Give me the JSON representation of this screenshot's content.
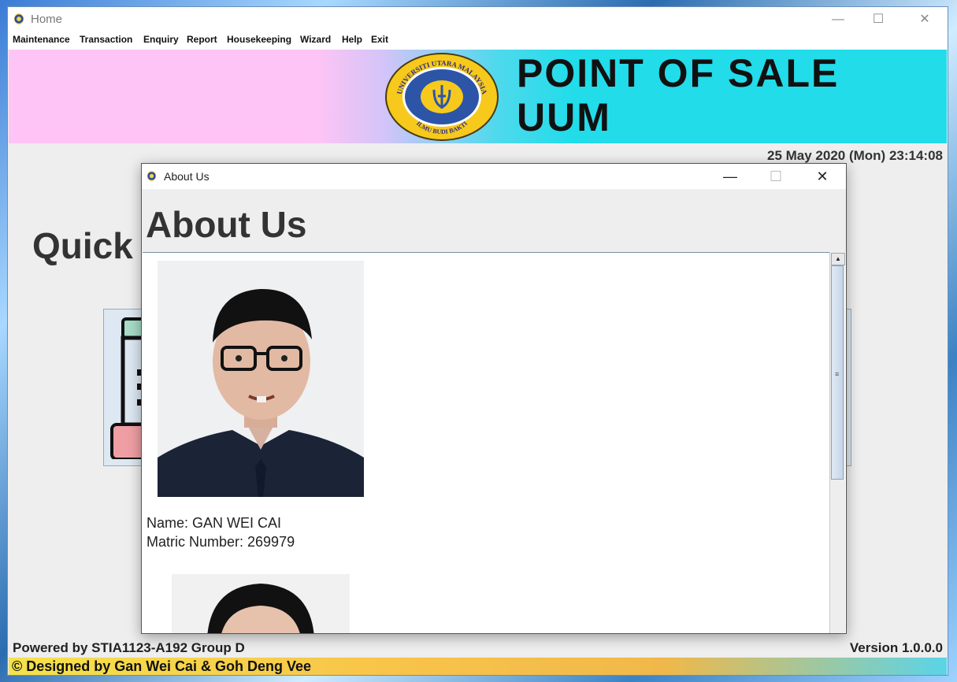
{
  "main_window": {
    "title": "Home",
    "controls": {
      "minimize": "—",
      "maximize": "☐",
      "close": "✕"
    }
  },
  "menu": {
    "items": [
      "Maintenance",
      "Transaction",
      "Enquiry",
      "Report",
      "Housekeeping",
      "Wizard",
      "Help",
      "Exit"
    ]
  },
  "banner": {
    "title": "POINT OF SALE",
    "subtitle": "UUM",
    "logo_text": "UNIVERSITI UTARA MALAYSIA",
    "logo_motto": "ILMU BUDI BAKTI"
  },
  "datetime": "25 May 2020 (Mon) 23:14:08",
  "quick_access": {
    "title": "Quick"
  },
  "footer": {
    "powered_by": "Powered by STIA1123-A192 Group D",
    "version": "Version 1.0.0.0",
    "credit": "© Designed by Gan Wei Cai & Goh Deng Vee"
  },
  "dialog": {
    "title": "About Us",
    "heading": "About Us",
    "controls": {
      "minimize": "—",
      "maximize": "☐",
      "close": "✕"
    },
    "members": [
      {
        "name_line": "Name: GAN WEI CAI",
        "matric_line": "Matric Number: 269979"
      }
    ],
    "scroll": {
      "up": "▲",
      "grip": "≡"
    }
  }
}
